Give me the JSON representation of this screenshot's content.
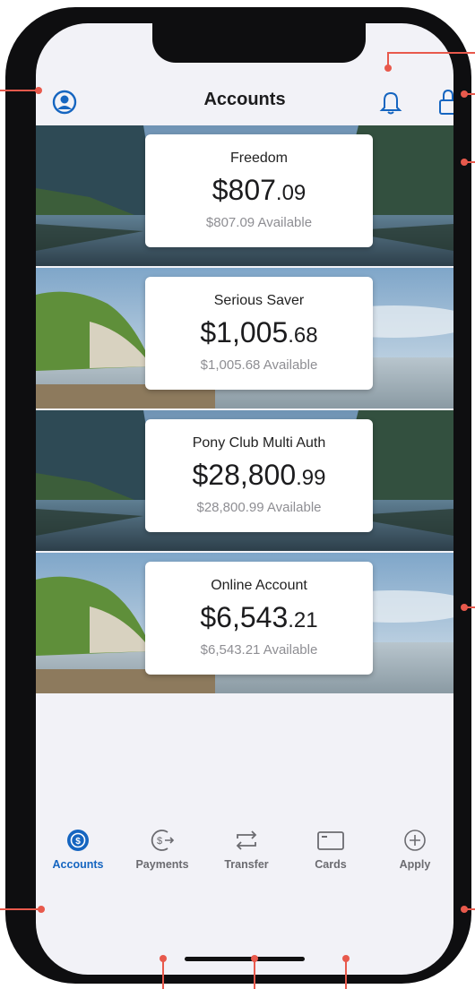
{
  "header": {
    "title": "Accounts"
  },
  "accounts": [
    {
      "name": "Freedom",
      "balance_main": "$807",
      "balance_cents": ".09",
      "available": "$807.09 Available"
    },
    {
      "name": "Serious Saver",
      "balance_main": "$1,005",
      "balance_cents": ".68",
      "available": "$1,005.68 Available"
    },
    {
      "name": "Pony Club Multi Auth",
      "balance_main": "$28,800",
      "balance_cents": ".99",
      "available": "$28,800.99 Available"
    },
    {
      "name": "Online Account",
      "balance_main": "$6,543",
      "balance_cents": ".21",
      "available": "$6,543.21 Available"
    }
  ],
  "tabs": [
    {
      "label": "Accounts",
      "icon": "accounts-icon",
      "active": true
    },
    {
      "label": "Payments",
      "icon": "payments-icon",
      "active": false
    },
    {
      "label": "Transfer",
      "icon": "transfer-icon",
      "active": false
    },
    {
      "label": "Cards",
      "icon": "cards-icon",
      "active": false
    },
    {
      "label": "Apply",
      "icon": "apply-icon",
      "active": false
    }
  ],
  "colors": {
    "accent": "#1565c0",
    "callout": "#e8594c",
    "tab_inactive": "#6b6b70"
  }
}
